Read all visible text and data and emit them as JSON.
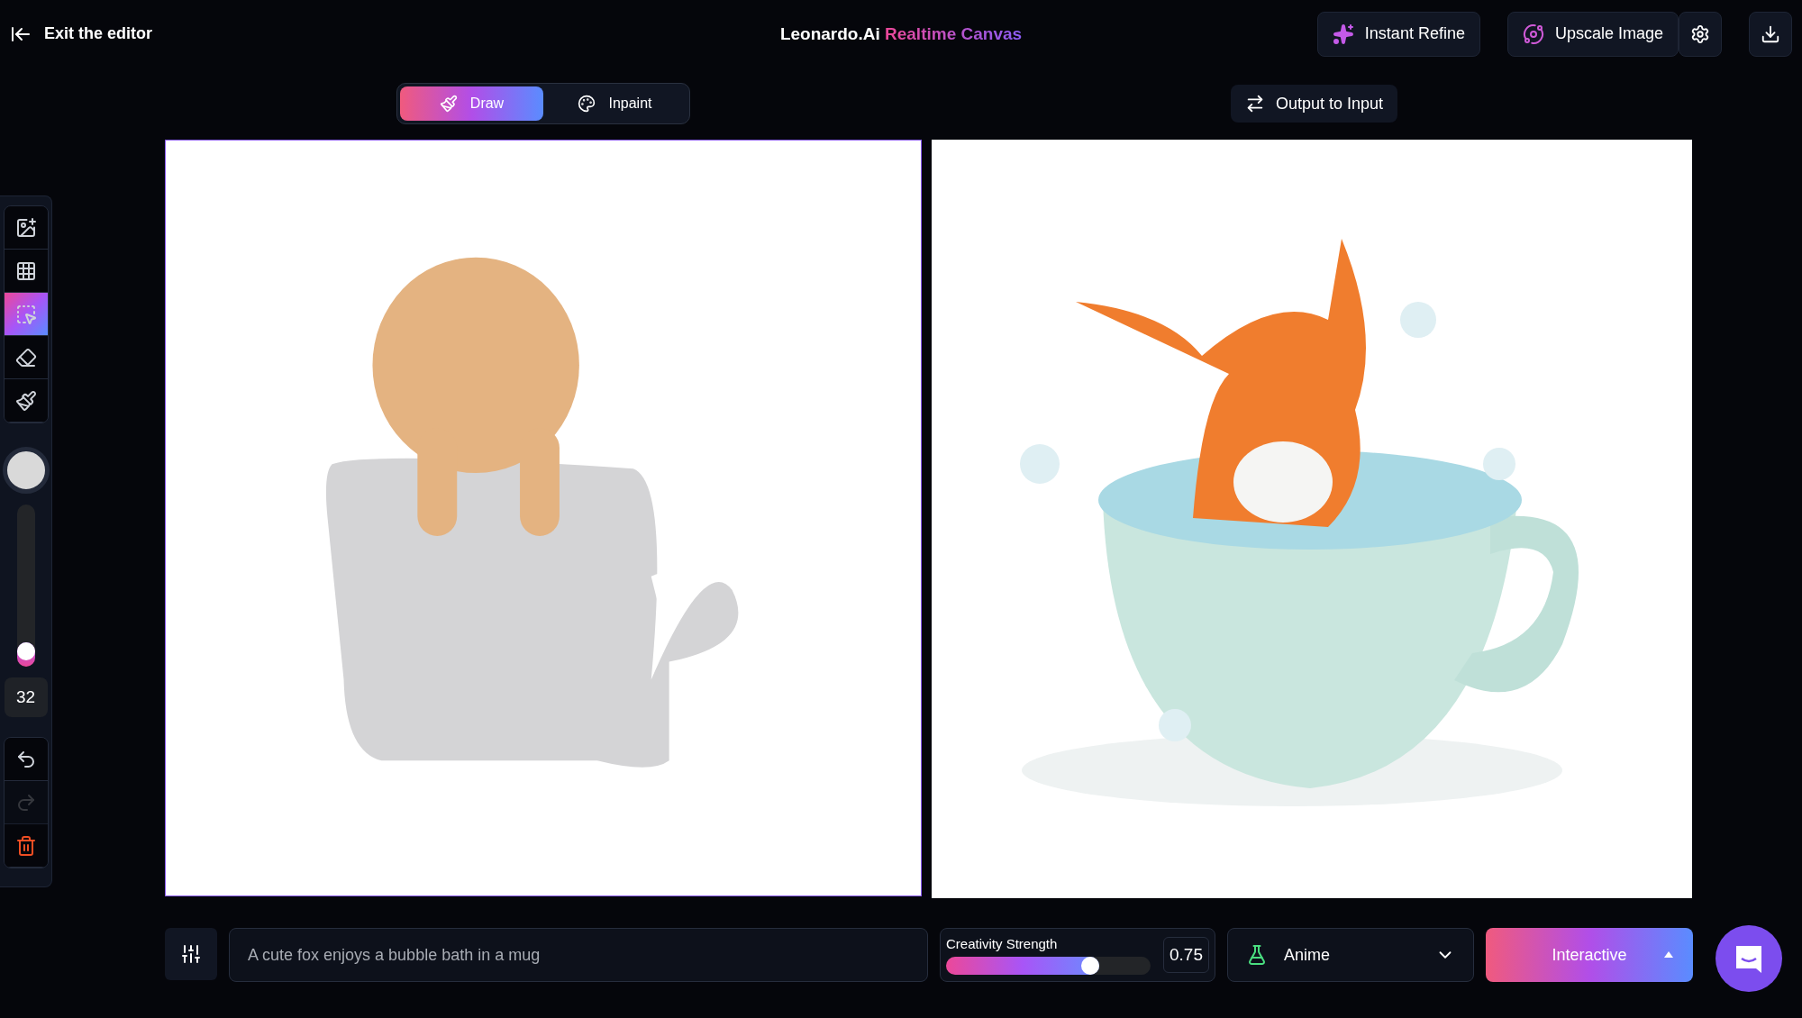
{
  "header": {
    "exit_label": "Exit the editor",
    "title_brand": "Leonardo.Ai",
    "title_product": "Realtime Canvas",
    "actions": [
      {
        "kind": "refine",
        "label": "Instant Refine"
      },
      {
        "kind": "upscale",
        "label": "Upscale Image"
      }
    ]
  },
  "mode_tabs": [
    {
      "kind": "draw",
      "label": "Draw",
      "selected": true
    },
    {
      "kind": "inpaint",
      "label": "Inpaint",
      "selected": false
    }
  ],
  "output_to_input": "Output to Input",
  "tools": [
    {
      "kind": "add-image",
      "selected": false
    },
    {
      "kind": "grid",
      "selected": false
    },
    {
      "kind": "select",
      "selected": true
    },
    {
      "kind": "eraser",
      "selected": false
    },
    {
      "kind": "brush",
      "selected": false
    }
  ],
  "brush": {
    "color": "#d9d9d9",
    "level": 0.15,
    "size": "32"
  },
  "history": [
    {
      "kind": "undo",
      "disabled": false
    },
    {
      "kind": "redo",
      "disabled": true
    },
    {
      "kind": "delete",
      "disabled": false
    }
  ],
  "prompt": {
    "value": "A cute fox enjoys a bubble bath in a mug"
  },
  "creativity": {
    "label": "Creativity Strength",
    "level": 0.75,
    "value": "0.75"
  },
  "style": {
    "value": "Anime"
  },
  "generate": {
    "label": "Interactive"
  }
}
